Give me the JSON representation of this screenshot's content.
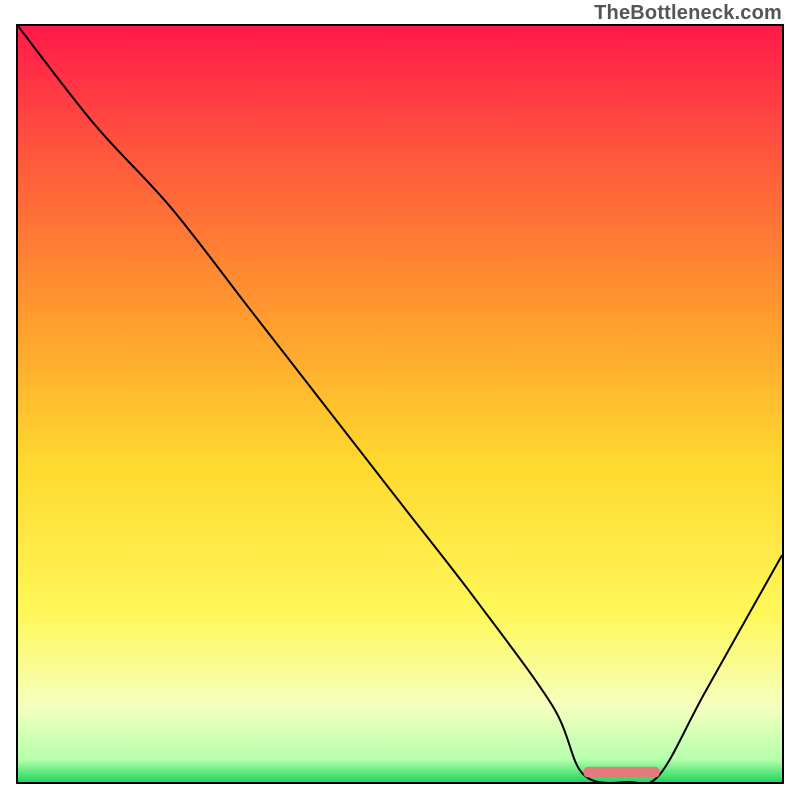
{
  "watermark": "TheBottleneck.com",
  "chart_data": {
    "type": "line",
    "title": "",
    "xlabel": "",
    "ylabel": "",
    "xlim": [
      0,
      100
    ],
    "ylim": [
      0,
      100
    ],
    "description": "Bottleneck shape over a red-to-green vertical gradient. High penalty on the left, descending to near-zero across a flat trough around x≈74–84, then rising again toward the right edge.",
    "series": [
      {
        "name": "curve",
        "x": [
          0,
          10,
          20,
          30,
          40,
          50,
          60,
          70,
          74,
          80,
          84,
          90,
          100
        ],
        "y": [
          100,
          87,
          76,
          63,
          50,
          37,
          24,
          10,
          1,
          0,
          1,
          12,
          30
        ]
      }
    ],
    "marker": {
      "name": "optimal-range",
      "x_start": 74,
      "x_end": 84,
      "y": 1.3,
      "color": "#e47a7a"
    },
    "gradient_stops": [
      {
        "offset": 0,
        "color": "#ff1a4b"
      },
      {
        "offset": 18,
        "color": "#ff5a3c"
      },
      {
        "offset": 38,
        "color": "#ff9a2e"
      },
      {
        "offset": 58,
        "color": "#ffd92e"
      },
      {
        "offset": 78,
        "color": "#fff85a"
      },
      {
        "offset": 90,
        "color": "#f5ffbf"
      },
      {
        "offset": 97,
        "color": "#b6ffad"
      },
      {
        "offset": 100,
        "color": "#1fd65a"
      }
    ]
  }
}
